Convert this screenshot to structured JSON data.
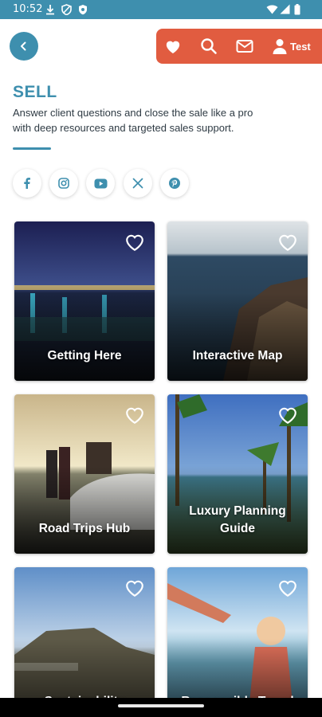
{
  "status_bar": {
    "time": "10:52"
  },
  "header": {
    "user_label": "Test"
  },
  "section": {
    "title": "SELL",
    "description": "Answer client questions and close the sale like a pro with deep resources and targeted sales support."
  },
  "social": [
    "facebook",
    "instagram",
    "youtube",
    "x",
    "pinterest"
  ],
  "cards": [
    {
      "label": "Getting Here"
    },
    {
      "label": "Interactive Map"
    },
    {
      "label": "Road Trips Hub"
    },
    {
      "label": "Luxury Planning Guide"
    },
    {
      "label": "Sustainability Resource Center"
    },
    {
      "label": "Responsible Travel Code"
    }
  ],
  "colors": {
    "brand": "#3e8fae",
    "accent": "#e15c40"
  }
}
